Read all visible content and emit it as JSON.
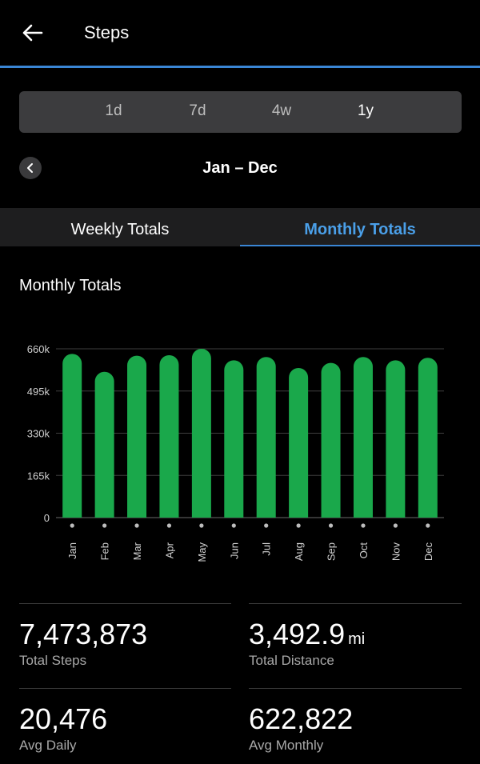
{
  "header": {
    "title": "Steps"
  },
  "range_options": [
    "1d",
    "7d",
    "4w",
    "1y"
  ],
  "range_selected": "1y",
  "period": {
    "label": "Jan – Dec"
  },
  "tabs": {
    "weekly": "Weekly Totals",
    "monthly": "Monthly Totals",
    "active": "monthly"
  },
  "section": {
    "title": "Monthly Totals"
  },
  "colors": {
    "bar": "#1aa84b",
    "accent": "#4a9fe8",
    "divider": "#3a86d4"
  },
  "chart_data": {
    "type": "bar",
    "categories": [
      "Jan",
      "Feb",
      "Mar",
      "Apr",
      "May",
      "Jun",
      "Jul",
      "Aug",
      "Sep",
      "Oct",
      "Nov",
      "Dec"
    ],
    "values": [
      640000,
      570000,
      633000,
      635000,
      660000,
      615000,
      628000,
      585000,
      605000,
      628000,
      615000,
      625000
    ],
    "yticks": [
      "0",
      "165k",
      "330k",
      "495k",
      "660k"
    ],
    "ylim": [
      0,
      660000
    ],
    "grid": true
  },
  "stats": {
    "total_steps": {
      "value": "7,473,873",
      "label": "Total Steps"
    },
    "total_distance": {
      "value": "3,492.9",
      "unit": "mi",
      "label": "Total Distance"
    },
    "avg_daily": {
      "value": "20,476",
      "label": "Avg Daily"
    },
    "avg_monthly": {
      "value": "622,822",
      "label": "Avg Monthly"
    }
  }
}
